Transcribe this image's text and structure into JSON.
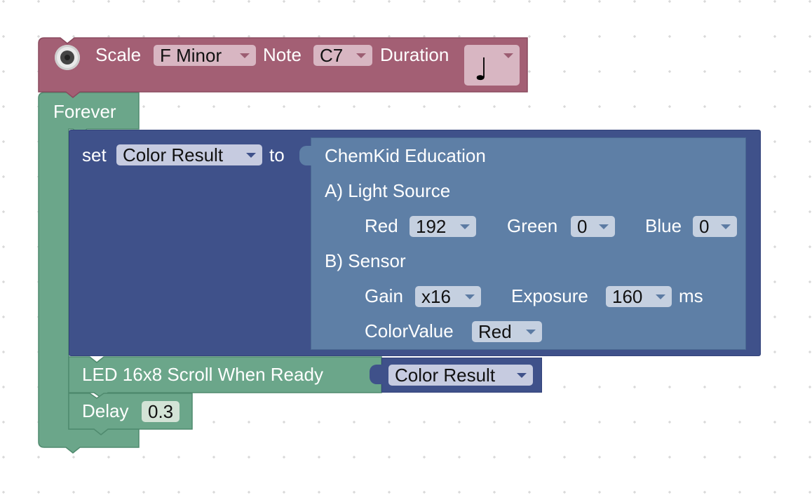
{
  "music_block": {
    "scale_label": "Scale",
    "scale_value": "F Minor",
    "note_label": "Note",
    "note_value": "C7",
    "duration_label": "Duration",
    "duration_icon": "quarter-note-icon",
    "duration_glyph": "♩",
    "speaker_icon": "speaker-icon",
    "colors": {
      "block": "#a35f74",
      "field": "#d8b6c2"
    }
  },
  "forever_block": {
    "label": "Forever",
    "colors": {
      "block": "#6ba68a"
    }
  },
  "set_block": {
    "set_label": "set",
    "variable": "Color Result",
    "to_label": "to",
    "colors": {
      "block": "#3f518a"
    }
  },
  "chemkid_block": {
    "title": "ChemKid Education",
    "light_source_label": "A) Light Source",
    "red_label": "Red",
    "red_value": "192",
    "green_label": "Green",
    "green_value": "0",
    "blue_label": "Blue",
    "blue_value": "0",
    "sensor_label": "B) Sensor",
    "gain_label": "Gain",
    "gain_value": "x16",
    "exposure_label": "Exposure",
    "exposure_value": "160",
    "exposure_unit": "ms",
    "colorvalue_label": "ColorValue",
    "colorvalue_value": "Red",
    "colors": {
      "block": "#5e7fa6"
    }
  },
  "led_block": {
    "label": "LED 16x8 Scroll When Ready",
    "variable": "Color Result",
    "colors": {
      "block": "#6ba68a"
    }
  },
  "delay_block": {
    "label": "Delay",
    "value": "0.3"
  }
}
